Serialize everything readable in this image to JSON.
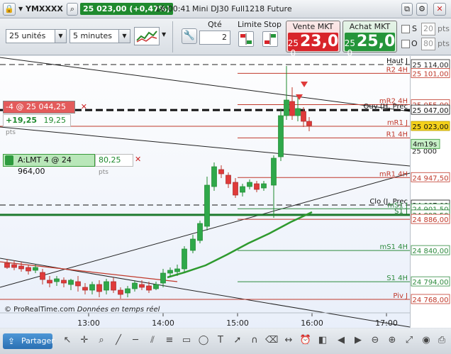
{
  "titlebar": {
    "instrument": "YMXXXX",
    "price_change": "25 023,00 (+0,47%)",
    "time": "16:00:41",
    "contract": "Mini DJ30 Full1218 Future"
  },
  "controls": {
    "units_select": "25 unités",
    "timeframe_select": "5 minutes",
    "qty_label": "Qté",
    "qty_value": "2",
    "limit_label": "Limite",
    "stop_label": "Stop",
    "sell": {
      "label": "Vente MKT",
      "small": "25 0",
      "big": "23,0",
      "color": "#d8242a"
    },
    "buy": {
      "label": "Achat MKT",
      "small": "25 0",
      "big": "25,0",
      "color": "#25953a"
    },
    "s_label": "S",
    "s_value": "20",
    "s_unit": "pts",
    "o_label": "O",
    "o_value": "80",
    "o_unit": "pts"
  },
  "chart": {
    "watermark": "© ProRealTime.com",
    "watermark_sub": "Données en temps réel",
    "time_labels": [
      "13:00",
      "14:00",
      "15:00",
      "16:00",
      "17:00"
    ],
    "position_box": {
      "label": "-4 @ 25 044,25",
      "pnl_points": "+19,25",
      "pnl_value": "19,25",
      "pnl_unit": "pts"
    },
    "limit_order": {
      "label": "A:LMT  4 @ 24 964,00",
      "distance": "80,25",
      "unit": "pts"
    },
    "countdown": "4m19s",
    "levels": [
      {
        "name": "Haut J",
        "price": "25 114,00"
      },
      {
        "name": "R2 4H",
        "price": "25 101,00"
      },
      {
        "name": "mR2 4H",
        "price": "25 055,00"
      },
      {
        "name": "Ouv (H, Prec",
        "price": "25 047,00"
      },
      {
        "name": "mR1 J",
        "price": "25 023,00"
      },
      {
        "name": "R1 4H",
        "price": ""
      },
      {
        "name": "mR1 4H",
        "price": "24 947,50"
      },
      {
        "name": "Clo (J, Prec",
        "price": "24 907,00"
      },
      {
        "name": "mS1 J",
        "price": "24 901,50"
      },
      {
        "name": "S1 J",
        "price": "24 892,50"
      },
      {
        "name": "",
        "price": "24 886,00"
      },
      {
        "name": "mS1 4H",
        "price": "24 840,00"
      },
      {
        "name": "S1 4H",
        "price": "24 794,00"
      },
      {
        "name": "Piv J",
        "price": "24 768,00"
      }
    ],
    "axis_extra_label": "25 000"
  },
  "bottombar": {
    "share_label": "Partager"
  }
}
